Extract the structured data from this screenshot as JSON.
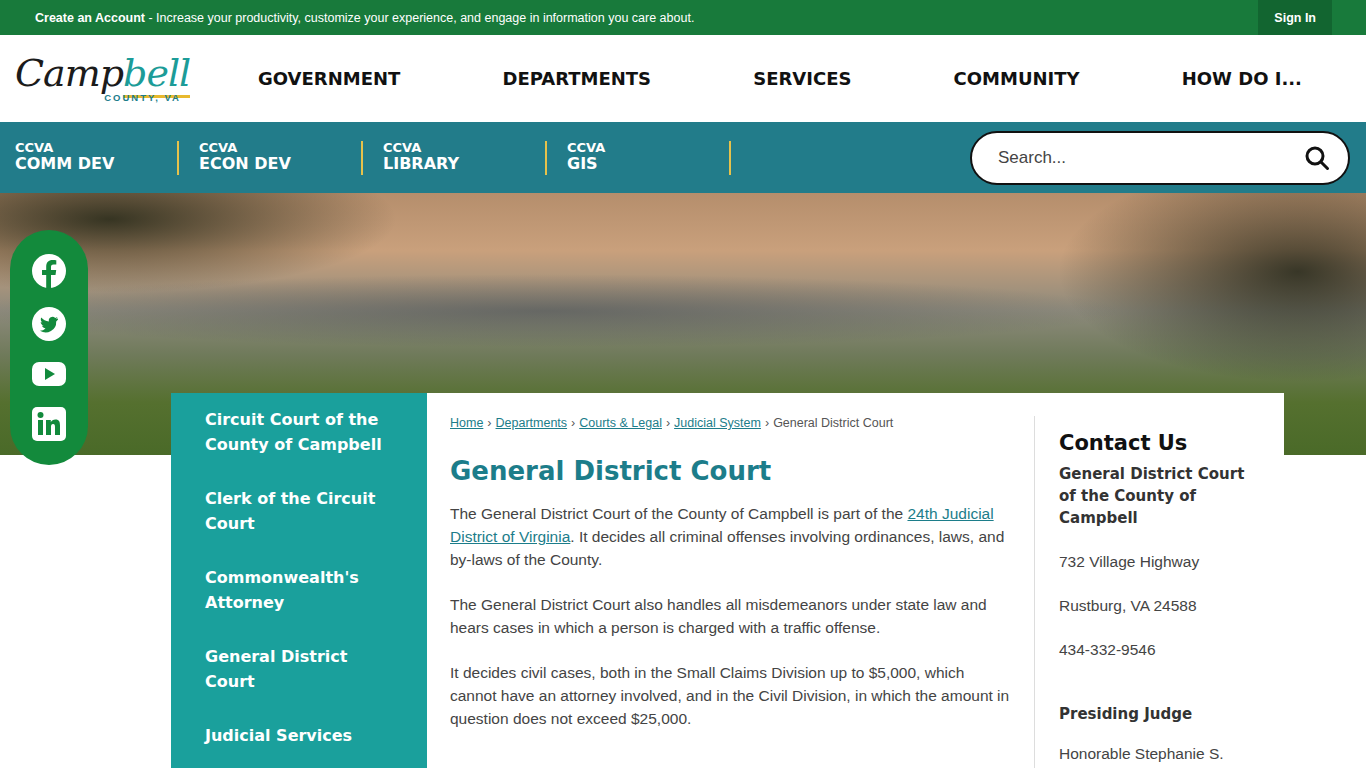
{
  "topbar": {
    "link": "Create an Account",
    "message": " - Increase your productivity, customize your experience, and engage in information you care about.",
    "sign_in": "Sign In"
  },
  "logo": {
    "part1": "Camp",
    "part2": "bell",
    "sub": "COUNTY, VA"
  },
  "nav": [
    "GOVERNMENT",
    "DEPARTMENTS",
    "SERVICES",
    "COMMUNITY",
    "HOW DO I..."
  ],
  "quick_links": [
    {
      "small": "CCVA",
      "label": "COMM DEV"
    },
    {
      "small": "CCVA",
      "label": "ECON DEV"
    },
    {
      "small": "CCVA",
      "label": "LIBRARY"
    },
    {
      "small": "CCVA",
      "label": "GIS"
    }
  ],
  "search": {
    "placeholder": "Search..."
  },
  "sidebar": {
    "items": [
      {
        "label": "Circuit Court of the County of Campbell",
        "selected": false
      },
      {
        "label": "Clerk of the Circuit Court",
        "selected": false
      },
      {
        "label": "Commonwealth's Attorney",
        "selected": false
      },
      {
        "label": "General District Court",
        "selected": false
      },
      {
        "label": "Judicial Services",
        "selected": false
      }
    ]
  },
  "breadcrumb": {
    "separator": "›",
    "links": [
      "Home",
      "Departments",
      "Courts & Legal",
      "Judicial System"
    ],
    "current": "General District Court"
  },
  "title": "General District Court",
  "paragraphs": [
    {
      "segments": [
        {
          "text": "The General District Court of the County of Campbell is part of the ",
          "link": false
        },
        {
          "text": "24th Judicial District of Virginia",
          "link": true
        },
        {
          "text": ". It decides all criminal offenses involving ordinances, laws, and by-laws of the County.",
          "link": false
        }
      ]
    },
    {
      "segments": [
        {
          "text": "The General District Court also handles all misdemeanors under state law and hears cases in which a person is charged with a traffic offense.",
          "link": false
        }
      ]
    },
    {
      "segments": [
        {
          "text": "It decides civil cases, both in the Small Claims Division up to $5,000, which cannot have an attorney involved, and in the Civil Division, in which the amount in question does not exceed $25,000.",
          "link": false
        }
      ]
    }
  ],
  "contact": {
    "heading": "Contact Us",
    "org": "General District Court of the County of Campbell",
    "lines": [
      "732 Village Highway",
      "Rustburg, VA 24588",
      "434-332-9546"
    ],
    "judge_heading": "Presiding Judge",
    "judge": "Honorable Stephanie S."
  }
}
